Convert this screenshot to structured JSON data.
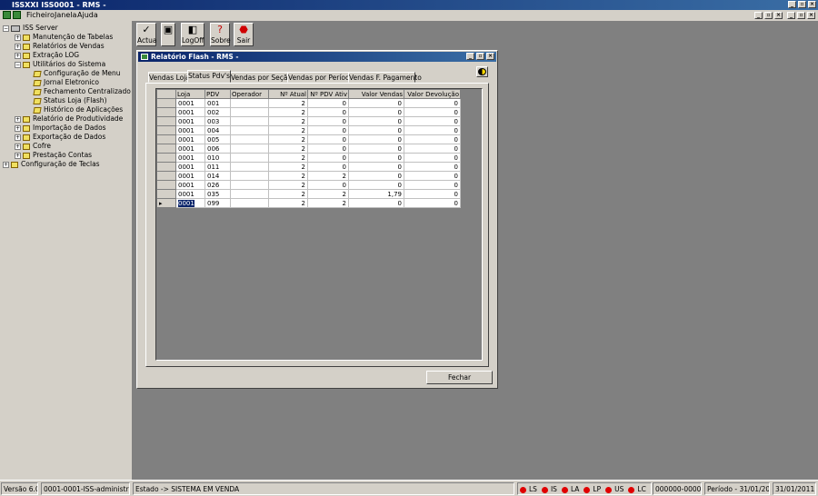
{
  "app": {
    "title": "ISSXXI ISS0001 - RMS -",
    "menu": [
      "Ficheiro",
      "Janela",
      "Ajuda"
    ]
  },
  "tree": [
    {
      "label": "ISS Server",
      "level": 0,
      "exp": "−",
      "icon": "server-icon"
    },
    {
      "label": "Manutenção de Tabelas",
      "level": 1,
      "exp": "+",
      "icon": "folder-icon"
    },
    {
      "label": "Relatórios de Vendas",
      "level": 1,
      "exp": "+",
      "icon": "folder-icon"
    },
    {
      "label": "Extração LOG",
      "level": 1,
      "exp": "+",
      "icon": "folder-icon"
    },
    {
      "label": "Utilitários do Sistema",
      "level": 1,
      "exp": "−",
      "icon": "folder-icon"
    },
    {
      "label": "Configuração de Menu",
      "level": 2,
      "exp": "",
      "icon": "document-icon"
    },
    {
      "label": "Jornal Eletronico",
      "level": 2,
      "exp": "",
      "icon": "document-icon"
    },
    {
      "label": "Fechamento Centralizado",
      "level": 2,
      "exp": "",
      "icon": "document-icon"
    },
    {
      "label": "Status Loja (Flash)",
      "level": 2,
      "exp": "",
      "icon": "document-icon"
    },
    {
      "label": "Histórico de Aplicações",
      "level": 2,
      "exp": "",
      "icon": "document-icon"
    },
    {
      "label": "Relatório de Produtividade",
      "level": 1,
      "exp": "+",
      "icon": "folder-icon"
    },
    {
      "label": "Importação de Dados",
      "level": 1,
      "exp": "+",
      "icon": "folder-icon"
    },
    {
      "label": "Exportação de Dados",
      "level": 1,
      "exp": "+",
      "icon": "folder-icon"
    },
    {
      "label": "Cofre",
      "level": 1,
      "exp": "+",
      "icon": "folder-icon"
    },
    {
      "label": "Prestação Contas",
      "level": 1,
      "exp": "+",
      "icon": "folder-icon"
    },
    {
      "label": "Configuração de Teclas",
      "level": 0,
      "exp": "+",
      "icon": "folder-icon"
    }
  ],
  "toolbar": {
    "actua": "Actua",
    "logoff": "LogOff",
    "sobre": "Sobre",
    "sair": "Sair"
  },
  "child": {
    "title": "Relatório Flash - RMS -",
    "tabs": [
      "Vendas Loja",
      "Status Pdv's",
      "Vendas por Seção",
      "Vendas por Período",
      "Vendas F. Pagamento"
    ],
    "active_tab": 1,
    "close_label": "Fechar"
  },
  "grid": {
    "columns": [
      "Loja",
      "PDV",
      "Operador",
      "Nº Atual",
      "Nº PDV Ativ",
      "Valor Vendas",
      "Valor Devolução"
    ],
    "rows": [
      [
        "0001",
        "001",
        "",
        "2",
        "0",
        "0",
        "0"
      ],
      [
        "0001",
        "002",
        "",
        "2",
        "0",
        "0",
        "0"
      ],
      [
        "0001",
        "003",
        "",
        "2",
        "0",
        "0",
        "0"
      ],
      [
        "0001",
        "004",
        "",
        "2",
        "0",
        "0",
        "0"
      ],
      [
        "0001",
        "005",
        "",
        "2",
        "0",
        "0",
        "0"
      ],
      [
        "0001",
        "006",
        "",
        "2",
        "0",
        "0",
        "0"
      ],
      [
        "0001",
        "010",
        "",
        "2",
        "0",
        "0",
        "0"
      ],
      [
        "0001",
        "011",
        "",
        "2",
        "0",
        "0",
        "0"
      ],
      [
        "0001",
        "014",
        "",
        "2",
        "2",
        "0",
        "0"
      ],
      [
        "0001",
        "026",
        "",
        "2",
        "0",
        "0",
        "0"
      ],
      [
        "0001",
        "035",
        "",
        "2",
        "2",
        "1,79",
        "0"
      ],
      [
        "0001",
        "099",
        "",
        "2",
        "2",
        "0",
        "0"
      ]
    ],
    "selected_row": 11
  },
  "status": {
    "version": "Versão 6.0",
    "user": "0001-0001-ISS-administrator",
    "state": "Estado -> SISTEMA EM VENDA",
    "leds": [
      "LS",
      "IS",
      "LA",
      "LP",
      "US",
      "LC"
    ],
    "counter": "000000-000000",
    "period": "Período - 31/01/2011",
    "date": "31/01/2011"
  },
  "colors": {
    "title_bar": "#0a246a",
    "led": "#e00000",
    "workspace": "#808080"
  }
}
